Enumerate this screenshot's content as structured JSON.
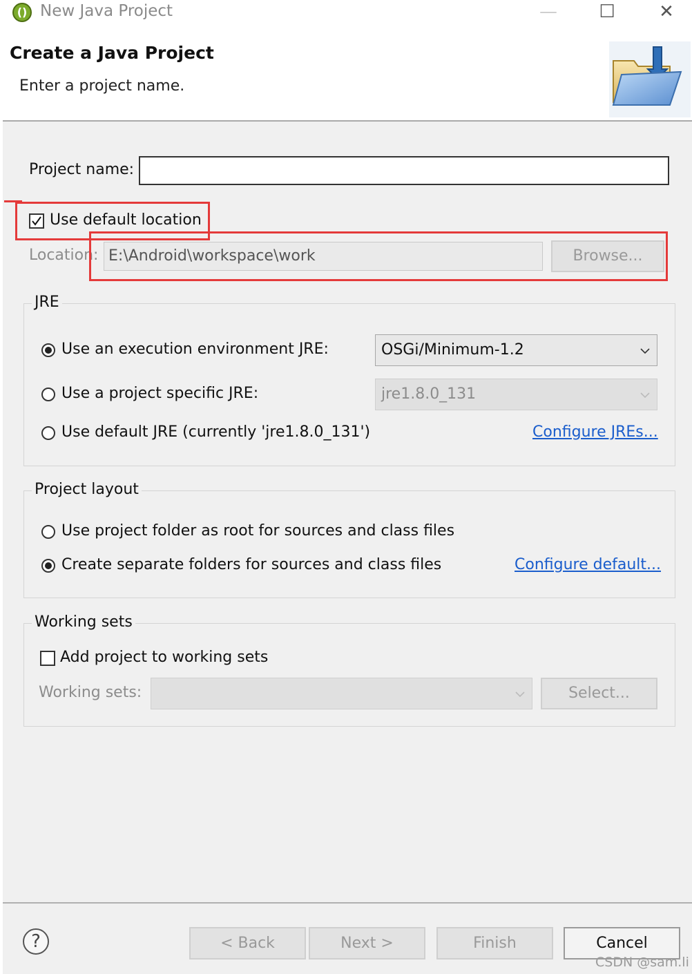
{
  "window": {
    "title": "New Java Project",
    "minimize_glyph": "—",
    "maximize_glyph": "☐",
    "close_glyph": "✕"
  },
  "header": {
    "title": "Create a Java Project",
    "subtitle": "Enter a project name."
  },
  "project": {
    "name_label": "Project name:",
    "name_value": "",
    "use_default_location_label": "Use default location",
    "use_default_location_checked": true,
    "location_label": "Location:",
    "location_value": "E:\\Android\\workspace\\work",
    "browse_label": "Browse..."
  },
  "jre": {
    "group_title": "JRE",
    "option_env_label": "Use an execution environment JRE:",
    "option_env_value": "OSGi/Minimum-1.2",
    "option_specific_label": "Use a project specific JRE:",
    "option_specific_value": "jre1.8.0_131",
    "option_default_label": "Use default JRE (currently 'jre1.8.0_131')",
    "configure_link": "Configure JREs...",
    "selected": "env"
  },
  "layout": {
    "group_title": "Project layout",
    "option_root_label": "Use project folder as root for sources and class files",
    "option_separate_label": "Create separate folders for sources and class files",
    "configure_link": "Configure default...",
    "selected": "separate"
  },
  "working_sets": {
    "group_title": "Working sets",
    "add_label": "Add project to working sets",
    "add_checked": false,
    "sets_label": "Working sets:",
    "sets_value": "",
    "select_label": "Select..."
  },
  "footer": {
    "help_glyph": "?",
    "back_label": "< Back",
    "next_label": "Next >",
    "finish_label": "Finish",
    "cancel_label": "Cancel"
  },
  "watermark": "CSDN @sam.li",
  "icons": [
    "eclipse-app-icon",
    "open-folder-icon",
    "help-icon",
    "chevron-down-icon"
  ],
  "colors": {
    "highlight": "#e43a3a",
    "link": "#1a5dcc",
    "dialog_bg": "#f0f0f0"
  }
}
